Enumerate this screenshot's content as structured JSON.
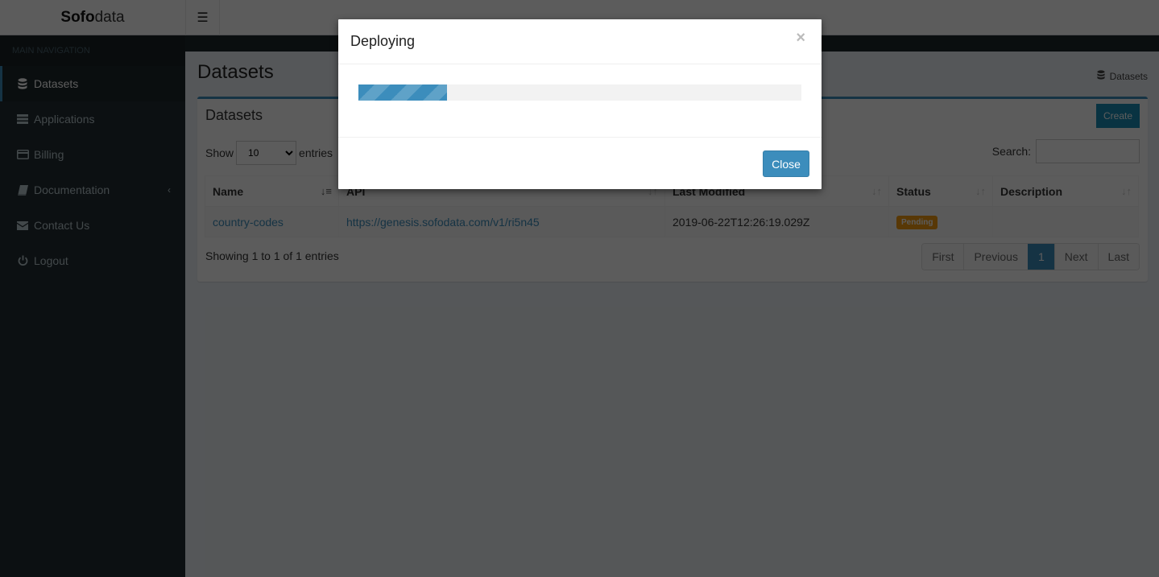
{
  "header": {
    "logo_bold": "Sofo",
    "logo_light": "data",
    "menu_toggle_icon": "hamburger-icon"
  },
  "sidebar": {
    "section_label": "MAIN NAVIGATION",
    "items": [
      {
        "label": "Datasets",
        "icon": "database-icon",
        "active": true
      },
      {
        "label": "Applications",
        "icon": "server-icon"
      },
      {
        "label": "Billing",
        "icon": "credit-card-icon"
      },
      {
        "label": "Documentation",
        "icon": "book-icon",
        "has_submenu": true
      },
      {
        "label": "Contact Us",
        "icon": "envelope-icon"
      },
      {
        "label": "Logout",
        "icon": "power-icon"
      }
    ]
  },
  "page": {
    "title": "Datasets",
    "breadcrumb": "Datasets"
  },
  "box": {
    "title": "Datasets",
    "create_label": "Create",
    "show_label": "Show",
    "entries_label": "entries",
    "page_length": "10",
    "search_label": "Search:",
    "search_value": "",
    "columns": [
      "Name",
      "API",
      "Last Modified",
      "Status",
      "Description"
    ],
    "rows": [
      {
        "name": "country-codes",
        "api": "https://genesis.sofodata.com/v1/ri5n45",
        "last_modified": "2019-06-22T12:26:19.029Z",
        "status": "Pending",
        "description": ""
      }
    ],
    "info": "Showing 1 to 1 of 1 entries",
    "pagination": [
      "First",
      "Previous",
      "1",
      "Next",
      "Last"
    ],
    "current_page": "1"
  },
  "modal": {
    "title": "Deploying",
    "close_symbol": "×",
    "progress_percent": 20,
    "close_label": "Close"
  },
  "colors": {
    "primary": "#3c8dbc",
    "pending": "#f39c12",
    "sidebar_bg": "#222d32"
  }
}
